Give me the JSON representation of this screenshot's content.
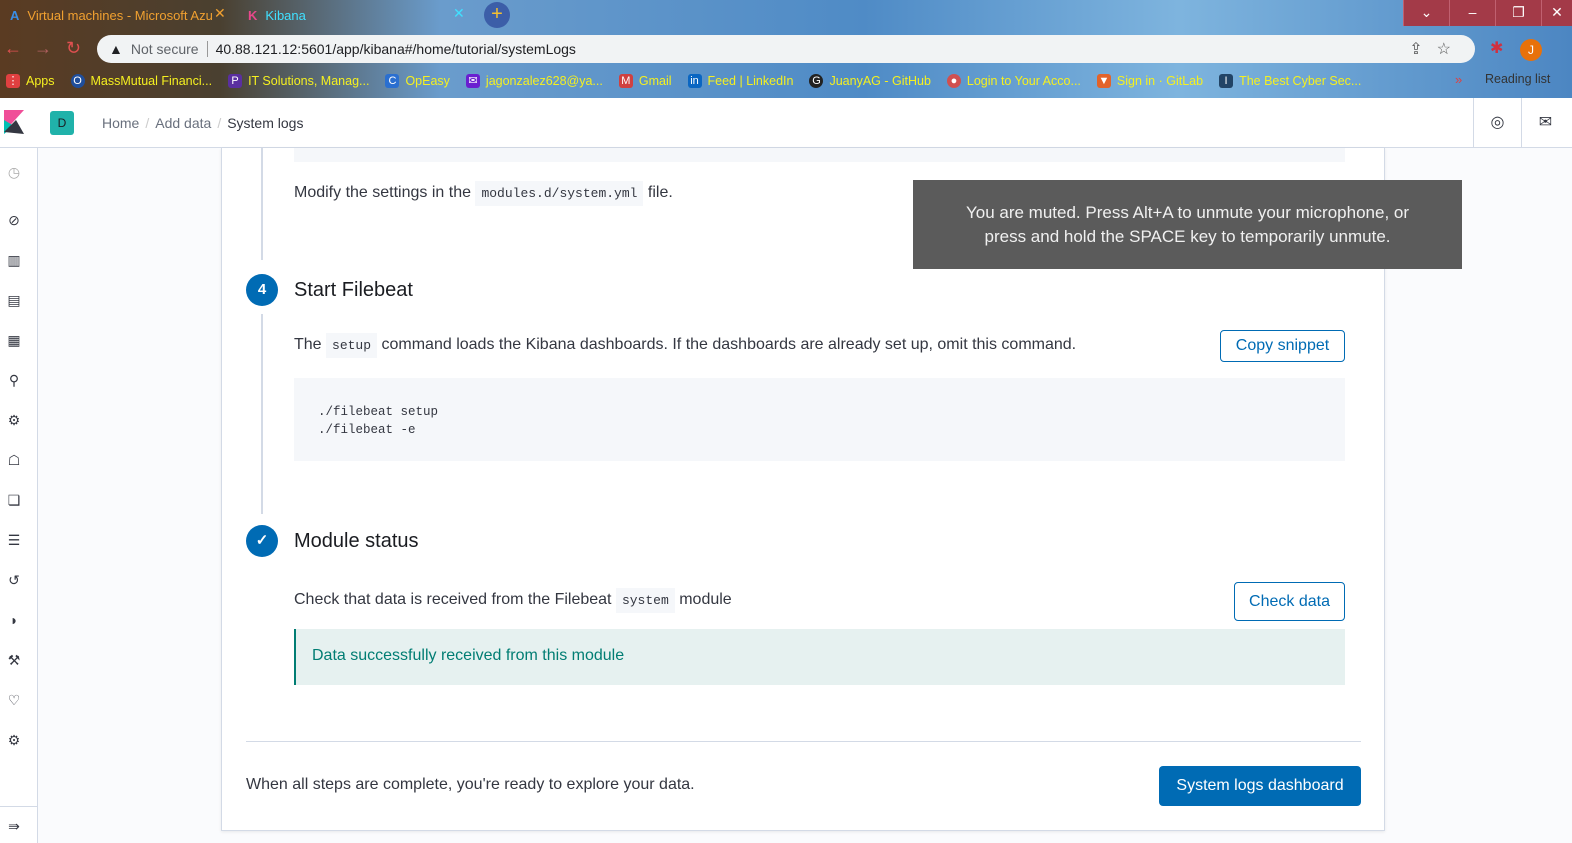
{
  "browser": {
    "tabs": [
      {
        "title": "Virtual machines - Microsoft Azu"
      },
      {
        "title": "Kibana"
      }
    ],
    "security": "Not secure",
    "url": "40.88.121.12:5601/app/kibana#/home/tutorial/systemLogs",
    "profile_initial": "J",
    "bookmarks": [
      "Apps",
      "MassMutual Financi...",
      "IT Solutions, Manag...",
      "OpEasy",
      "jagonzalez628@ya...",
      "Gmail",
      "Feed | LinkedIn",
      "JuanyAG - GitHub",
      "Login to Your Acco...",
      "Sign in · GitLab",
      "The Best Cyber Sec..."
    ],
    "reading_list": "Reading list",
    "more": "»"
  },
  "kibana": {
    "space_initial": "D",
    "breadcrumbs": [
      "Home",
      "Add data",
      "System logs"
    ]
  },
  "content": {
    "modify_pre": "Modify the settings in the",
    "modify_code": "modules.d/system.yml",
    "modify_post": "file.",
    "step4": {
      "num": "4",
      "title": "Start Filebeat",
      "pre": "The",
      "code": "setup",
      "post": "command loads the Kibana dashboards. If the dashboards are already set up, omit this command.",
      "copy": "Copy snippet",
      "lines": [
        "./filebeat setup",
        "./filebeat -e"
      ]
    },
    "status": {
      "check": "✓",
      "title": "Module status",
      "pre": "Check that data is received from the Filebeat",
      "code": "system",
      "post": "module",
      "button": "Check data",
      "callout": "Data successfully received from this module"
    },
    "footer_text": "When all steps are complete, you're ready to explore your data.",
    "dashboard_button": "System logs dashboard"
  },
  "toast": {
    "line1": "You are muted. Press Alt+A to unmute your microphone, or",
    "line2": "press and hold the SPACE key to temporarily unmute."
  }
}
